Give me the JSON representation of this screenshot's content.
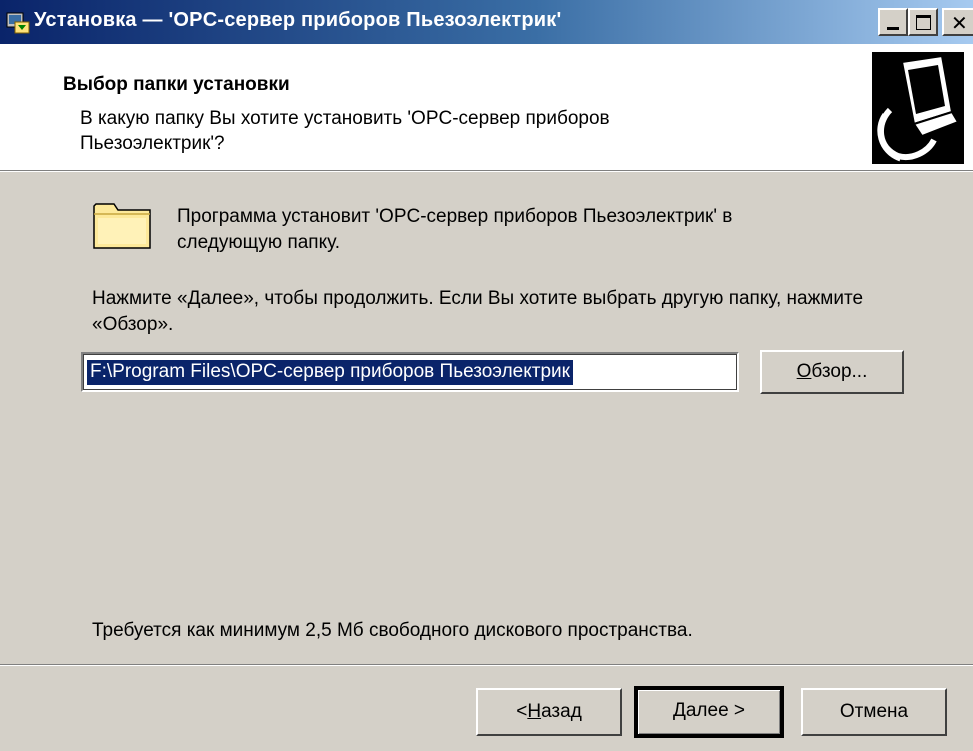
{
  "window": {
    "title": "Установка — 'OPC-сервер приборов Пьезоэлектрик'",
    "controls": [
      "minimize",
      "maximize",
      "close"
    ]
  },
  "header": {
    "title": "Выбор папки установки",
    "subtitle": "В какую папку Вы хотите установить 'OPC-сервер приборов Пьезоэлектрик'?"
  },
  "body": {
    "intro": "Программа установит 'OPC-сервер приборов Пьезоэлектрик' в следующую папку.",
    "instruction": "Нажмите «Далее», чтобы продолжить. Если Вы хотите выбрать другую папку, нажмите «Обзор».",
    "path_value": "F:\\Program Files\\OPC-сервер приборов Пьезоэлектрик",
    "browse_label_u": "О",
    "browse_label_rest": "бзор...",
    "space_required": "Требуется как минимум 2,5 Мб свободного дискового пространства."
  },
  "footer": {
    "back_prefix": "< ",
    "back_u": "Н",
    "back_rest": "азад",
    "next_u": "Д",
    "next_rest": "алее >",
    "cancel_label": "Отмена"
  },
  "colors": {
    "window_bg": "#d4d0c8",
    "title_start": "#0a246a",
    "title_end": "#a6caf0",
    "selection": "#0a246a"
  },
  "icons": {
    "title": "installer-icon",
    "header": "computer-install-icon",
    "folder": "folder-icon"
  }
}
